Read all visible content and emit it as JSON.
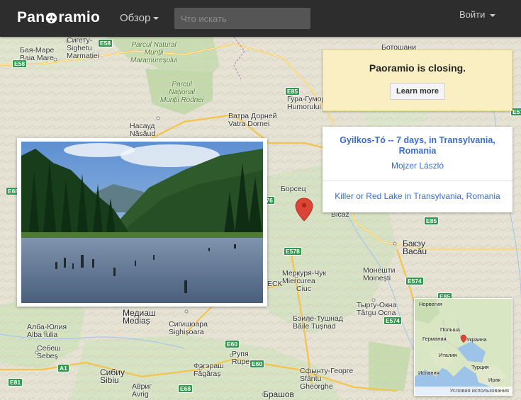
{
  "header": {
    "logo_text_left": "Pan",
    "logo_text_right": "ramio",
    "browse_label": "Обзор",
    "search_placeholder": "Что искать",
    "login_label": "Войти"
  },
  "notice": {
    "title": "Paoramio is closing.",
    "button_label": "Learn more"
  },
  "photo_card": {
    "title": "Gyilkos-Tó -- 7 days, in Transylvania, Romania",
    "author": "Mojzer László",
    "description": "Killer or Red Lake in Transylvania, Romania"
  },
  "map": {
    "labels": {
      "baia_mare_cyr": "Бая-Маре",
      "baia_mare": "Baia Mare",
      "sighetu_cyr": "Сигету-",
      "sighetu": "Sighetu",
      "marmatiei": "Marmației",
      "parc_maramuresului": "Parcul Natural\nMunții\nMaramureșului",
      "parc_rodnei": "Parcul\nNațional\nMunții Rodnei",
      "botosani": "Ботошани",
      "gura_humorului_cyr": "Гура-Гумор",
      "gura_humorului": "Humorului",
      "vatra_dornei_cyr": "Ватра Дорней",
      "vatra_dornei": "Vatra Dornei",
      "nasaud_cyr": "Насауд",
      "nasaud": "Năsăud",
      "borsec": "Борсец",
      "bicaz": "Bicaz",
      "bacau_cyr": "Бакэу",
      "bacau": "Bacău",
      "miercurea_cyr": "Меркуря-Чук",
      "miercurea": "Miercurea",
      "ciuc": "Ciuc",
      "moinesti_cyr": "Монешти",
      "moinesti": "Moinești",
      "targu_ocna_cyr": "Тыргу-Окна",
      "targu_ocna": "Târgu Ocna",
      "baile_tusnad_cyr": "Бэиле-Тушнад",
      "baile_tusnad": "Băile Tușnad",
      "medias_cyr": "Медиаш",
      "medias": "Mediaș",
      "sighisoara_cyr": "Сигишоара",
      "sighisoara": "Sighișoara",
      "alba_iulia_cyr": "Алба-Юлия",
      "alba_iulia": "Alba Iulia",
      "sebes_cyr": "Себеш",
      "sebes": "Sebeș",
      "sibiu_cyr": "Сибиу",
      "sibiu": "Sibiu",
      "avrig_cyr": "Авриг",
      "avrig": "Avrig",
      "rupea_cyr": "Рупя",
      "rupea": "Rupea",
      "fagaras_cyr": "Фэгэраш",
      "fagaras": "Făgăraș",
      "sfantu_cyr": "Сфынту-Георге",
      "sfantu": "Sfântu",
      "gheorghe": "Gheorghe",
      "brasov_cyr": "Брашов",
      "besc": "ЕСК"
    },
    "roads": [
      "E58",
      "E58",
      "E85",
      "E576",
      "E578",
      "E578",
      "E85",
      "E574",
      "E85",
      "E574",
      "E60",
      "E60",
      "E68",
      "A1",
      "E81",
      "E68"
    ]
  },
  "minimap": {
    "labels": {
      "norway": "Норвегия",
      "poland": "Польша",
      "germany": "Германия",
      "ukraine": "Украина",
      "italy": "Италия",
      "spain": "Испания",
      "turkey": "Турция",
      "iraq": "Ирак"
    },
    "terms": "Условия использования"
  },
  "colors": {
    "header_bg": "#2d2d2d",
    "notice_bg": "#faeec3",
    "link_blue": "#3a6cc9",
    "road_green": "#2f9a4d",
    "marker_red": "#db4437"
  }
}
